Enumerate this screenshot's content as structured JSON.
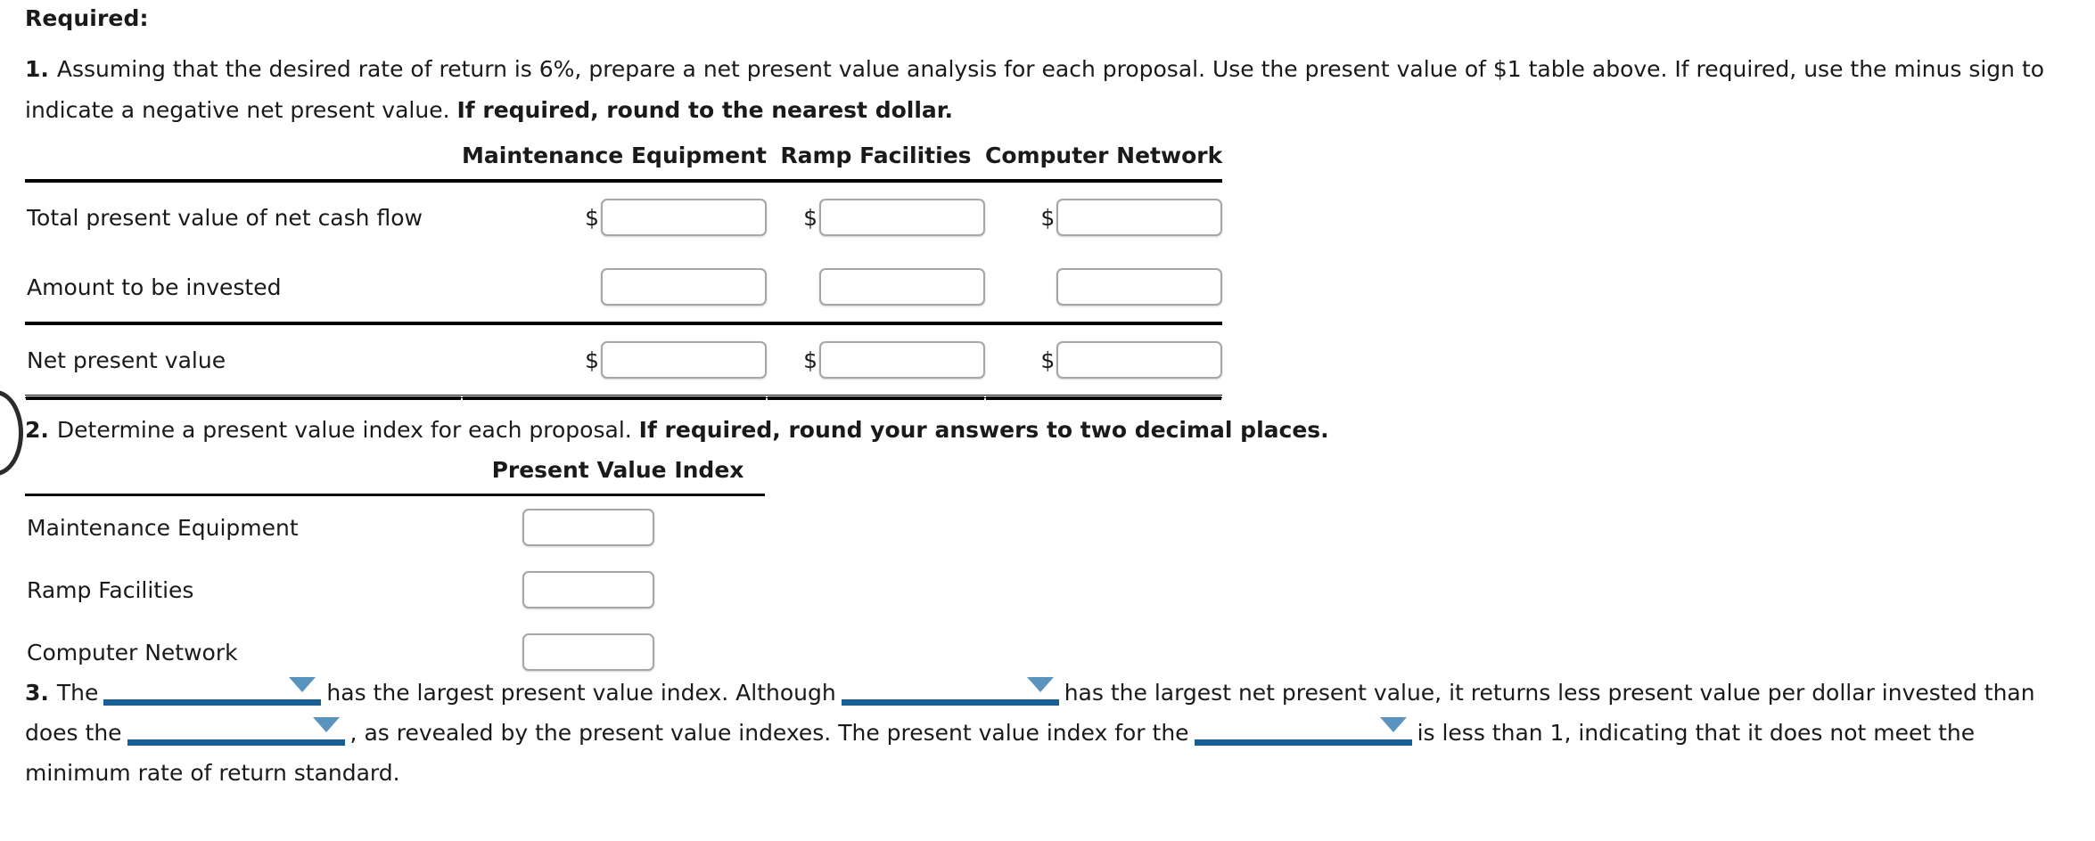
{
  "page": {
    "required_heading": "Required:"
  },
  "item1": {
    "number": "1.",
    "text_part1": "Assuming that the desired rate of return is 6%, prepare a net present value analysis for each proposal. Use the present value of $1 table above. If required, use the minus sign to indicate a negative net present value. ",
    "text_bold": "If required, round to the nearest dollar."
  },
  "npv_table": {
    "columns": [
      "",
      "Maintenance Equipment",
      "Ramp Facilities",
      "Computer Network"
    ],
    "rows": [
      {
        "label": "Total present value of net cash flow",
        "currency": [
          "$",
          "$",
          "$"
        ],
        "values": [
          "",
          "",
          ""
        ]
      },
      {
        "label": "Amount to be invested",
        "currency": [
          "",
          "",
          ""
        ],
        "values": [
          "",
          "",
          ""
        ]
      },
      {
        "label": "Net present value",
        "currency": [
          "$",
          "$",
          "$"
        ],
        "values": [
          "",
          "",
          ""
        ]
      }
    ]
  },
  "item2": {
    "number": "2.",
    "text_part1": "Determine a present value index for each proposal. ",
    "text_bold": "If required, round your answers to two decimal places."
  },
  "pvi_table": {
    "columns": [
      "",
      "Present Value Index"
    ],
    "rows": [
      {
        "label": "Maintenance Equipment",
        "value": ""
      },
      {
        "label": "Ramp Facilities",
        "value": ""
      },
      {
        "label": "Computer Network",
        "value": ""
      }
    ]
  },
  "item3": {
    "number": "3.",
    "seg1": "The",
    "dropdown1": "",
    "seg2": "has the largest present value index. Although",
    "dropdown2": "",
    "seg3": "has the largest net present value, it returns less present value per dollar invested than does the",
    "dropdown3": "",
    "seg4": ", as revealed by the present value indexes. The present value index for the",
    "dropdown4": "",
    "seg5": "is less than 1, indicating that it does not meet the minimum rate of return standard."
  },
  "colors": {
    "dropdown_triangle": "#5b93bf",
    "dropdown_underline": "#175f94",
    "input_border": "#a6a6a6",
    "rule": "#000000",
    "text": "#1a1a1a"
  }
}
